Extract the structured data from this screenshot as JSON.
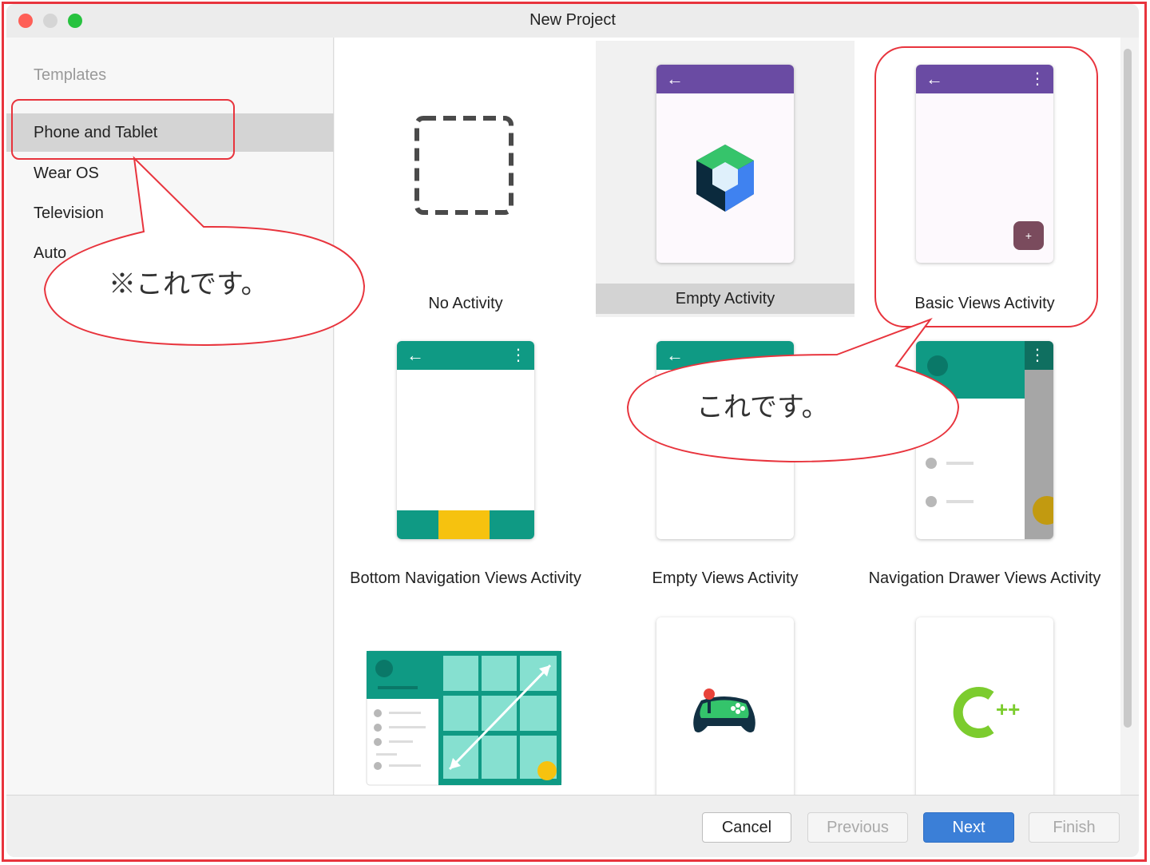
{
  "window": {
    "title": "New Project"
  },
  "sidebar": {
    "header": "Templates",
    "items": [
      {
        "label": "Phone and Tablet",
        "selected": true
      },
      {
        "label": "Wear OS",
        "selected": false
      },
      {
        "label": "Television",
        "selected": false
      },
      {
        "label": "Auto",
        "selected": false
      }
    ]
  },
  "templates": [
    {
      "label": "No Activity",
      "icon": "dashed-square-icon"
    },
    {
      "label": "Empty Activity",
      "icon": "compose-hexagon-icon",
      "selected": true
    },
    {
      "label": "Basic Views Activity",
      "icon": "phone-fab-icon"
    },
    {
      "label": "Bottom Navigation Views Activity",
      "icon": "phone-bottom-nav-icon"
    },
    {
      "label": "Empty Views Activity",
      "icon": "phone-empty-icon"
    },
    {
      "label": "Navigation Drawer Views Activity",
      "icon": "phone-drawer-icon"
    },
    {
      "label": "",
      "icon": "responsive-grid-icon"
    },
    {
      "label": "",
      "icon": "game-controller-icon"
    },
    {
      "label": "",
      "icon": "cpp-icon"
    }
  ],
  "buttons": {
    "cancel": "Cancel",
    "previous": "Previous",
    "next": "Next",
    "finish": "Finish"
  },
  "annotations": {
    "callout_left": "※これです。",
    "callout_right": "これです。"
  },
  "colors": {
    "accent_purple": "#6a4ba3",
    "accent_teal": "#0f9a84",
    "accent_yellow": "#f6c20f",
    "next_button": "#3b7fd7",
    "annotation_red": "#e8343d"
  }
}
